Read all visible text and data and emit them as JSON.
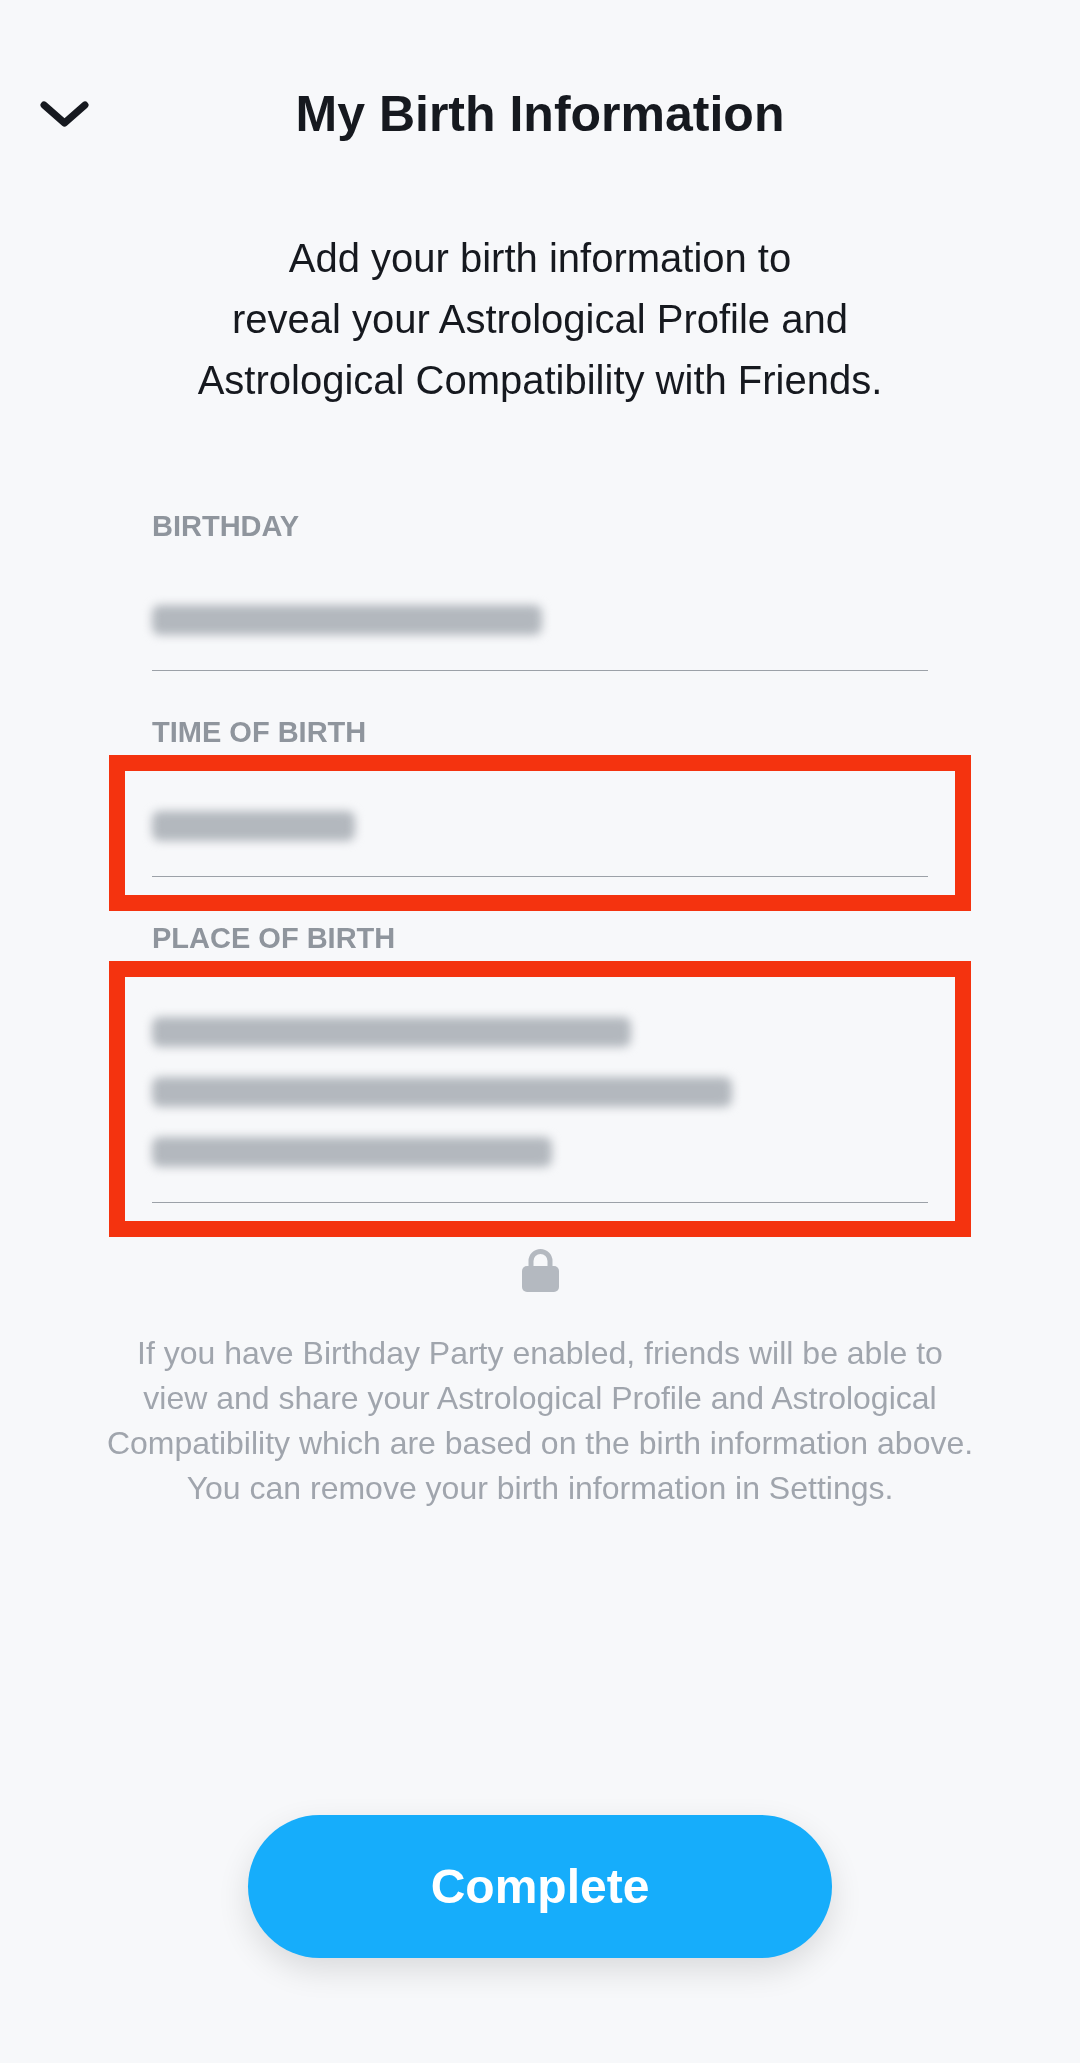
{
  "header": {
    "title": "My Birth Information"
  },
  "intro": "Add your birth information to reveal your Astrological Profile and Astrological Compatibility with Friends.",
  "fields": [
    {
      "label": "BIRTHDAY",
      "redacted": true,
      "highlighted": false
    },
    {
      "label": "TIME OF BIRTH",
      "redacted": true,
      "highlighted": true
    },
    {
      "label": "PLACE OF BIRTH",
      "redacted": true,
      "highlighted": true
    }
  ],
  "disclaimer": "If you have Birthday Party enabled, friends will be able to view and share your Astrological Profile and Astrological Compatibility which are based on the birth information above. You can remove your birth information in Settings.",
  "button": {
    "label": "Complete"
  }
}
